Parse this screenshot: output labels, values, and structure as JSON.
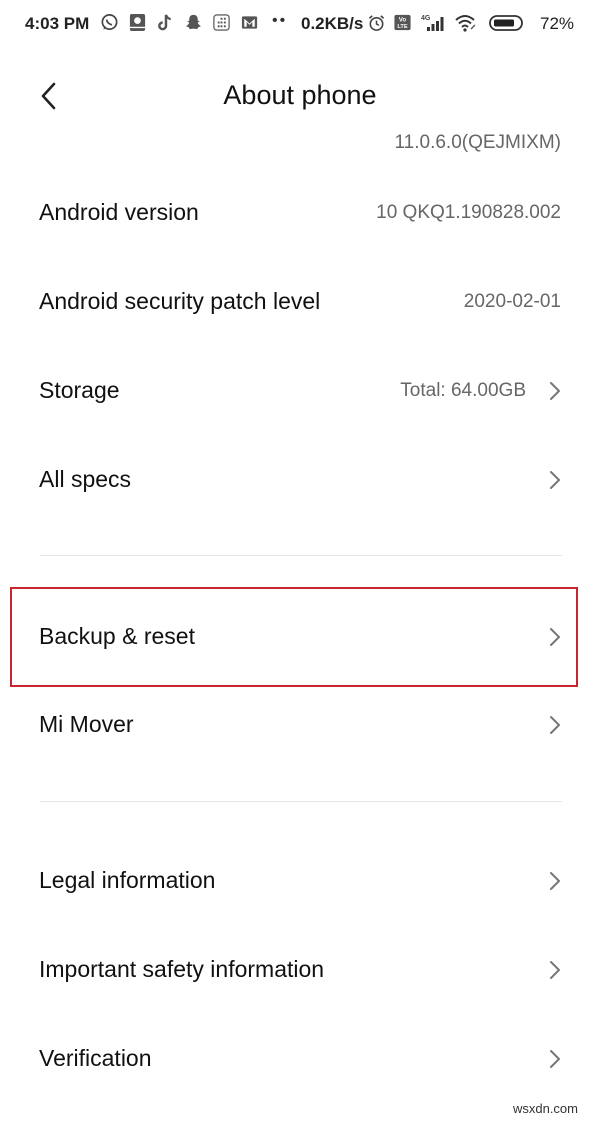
{
  "status_bar": {
    "time": "4:03 PM",
    "left_icons": [
      "whatsapp-icon",
      "gallery-app-icon",
      "tiktok-icon",
      "snapchat-icon",
      "calculator-icon",
      "gmail-icon"
    ],
    "more_dots": "••",
    "network_speed": "0.2KB/s",
    "right_icons": [
      "alarm-icon",
      "volte-icon",
      "4g-signal-icon",
      "wifi-icon",
      "battery-icon"
    ],
    "network_type": "4G",
    "battery_percent": "72%",
    "battery_level": 0.72
  },
  "header": {
    "title": "About phone",
    "back_icon": "chevron-left-icon"
  },
  "partial_row": {
    "value": "11.0.6.0(QEJMIXM)"
  },
  "rows": [
    {
      "label": "Android version",
      "value": "10 QKQ1.190828.002",
      "chevron": false
    },
    {
      "label": "Android security patch level",
      "value": "2020-02-01",
      "chevron": false
    },
    {
      "label": "Storage",
      "value": "Total: 64.00GB",
      "chevron": true
    },
    {
      "label": "All specs",
      "value": "",
      "chevron": true
    },
    {
      "label": "Backup & reset",
      "value": "",
      "chevron": true,
      "highlighted": true
    },
    {
      "label": "Mi Mover",
      "value": "",
      "chevron": true
    },
    {
      "label": "Legal information",
      "value": "",
      "chevron": true
    },
    {
      "label": "Important safety information",
      "value": "",
      "chevron": true
    },
    {
      "label": "Verification",
      "value": "",
      "chevron": true
    }
  ],
  "highlight_color": "#c8262d",
  "watermark": "wsxdn.com"
}
